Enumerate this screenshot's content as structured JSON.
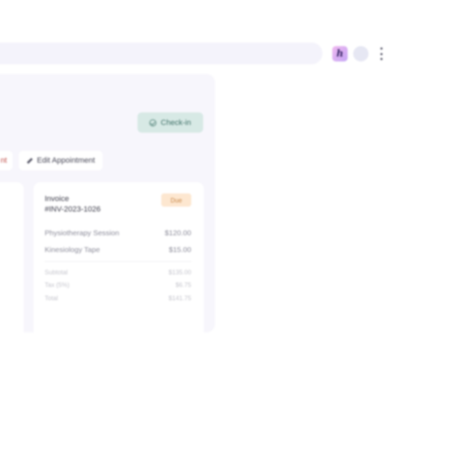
{
  "browser": {
    "extension_icon_letter": "h",
    "extension_colors": [
      "#f0b8f0",
      "#c4a6f5"
    ],
    "avatar_color": "#e6e7f3",
    "menu_icon": "kebab-menu-icon"
  },
  "actions": {
    "checkin_label": "Check-in",
    "partial_label": "nt",
    "edit_label": "Edit Appointment"
  },
  "invoice": {
    "title": "Invoice",
    "number": "#INV-2023-1026",
    "status": "Due",
    "items": [
      {
        "label": "Physiotherapy Session",
        "amount": "$120.00"
      },
      {
        "label": "Kinesiology Tape",
        "amount": "$15.00"
      }
    ],
    "summary": [
      {
        "label": "Subtotal",
        "amount": "$135.00"
      },
      {
        "label": "Tax (5%)",
        "amount": "$6.75"
      },
      {
        "label": "Total",
        "amount": "$141.75"
      }
    ]
  },
  "colors": {
    "checkin_bg": "#d7e9e5",
    "due_badge_bg": "#fde7d0",
    "danger_text": "#c0504a"
  }
}
